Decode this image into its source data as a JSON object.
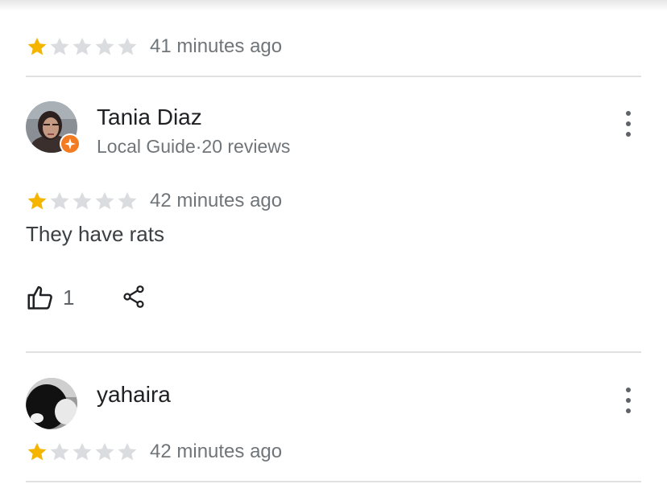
{
  "reviews": [
    {
      "rating": 1,
      "time": "41 minutes ago"
    },
    {
      "author": "Tania Diaz",
      "meta": "Local Guide·20 reviews",
      "rating": 1,
      "time": "42 minutes ago",
      "text": "They have rats",
      "likes": "1"
    },
    {
      "author": "yahaira",
      "rating": 1,
      "time": "42 minutes ago"
    }
  ],
  "colors": {
    "star_filled": "#F4B400",
    "star_empty": "#DADCE0",
    "badge": "#F37C22"
  },
  "icons": [
    "star-icon",
    "local-guide-badge-icon",
    "more-options-icon",
    "thumbs-up-icon",
    "share-icon"
  ]
}
